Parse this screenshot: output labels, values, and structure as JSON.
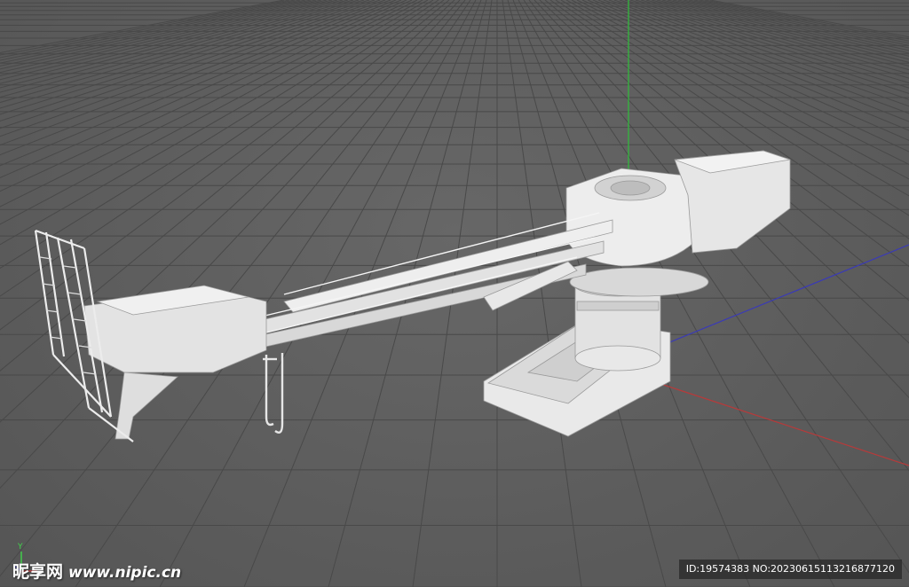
{
  "viewport": {
    "background_color": "#5e5e5e",
    "grid_color": "#494949",
    "model_color": "#e6e6e6",
    "axis_colors": {
      "x": "#b73a3a",
      "y": "#2fbf3a",
      "z": "#3a3ab7"
    },
    "gizmo_label": "Y"
  },
  "watermark": {
    "logo_text": "昵享网",
    "site_text": "www.nipic.cn",
    "id_text": "ID:19574383 NO:20230615113216877120"
  }
}
